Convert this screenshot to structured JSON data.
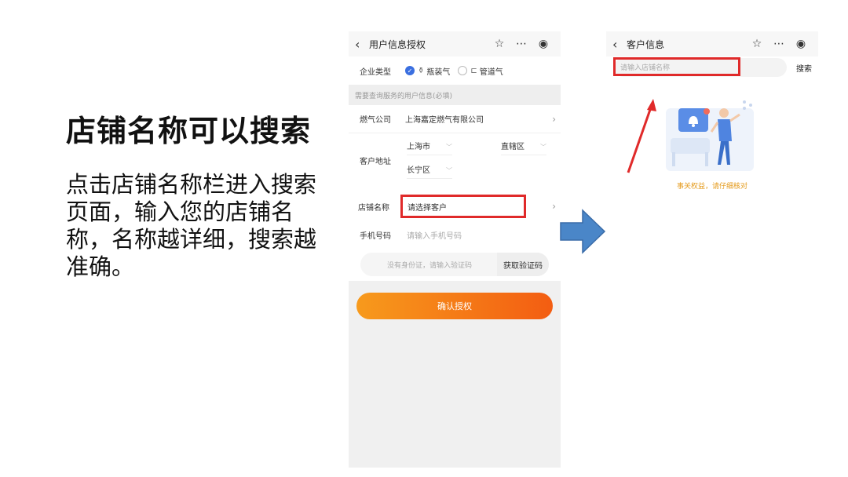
{
  "slide": {
    "title": "店铺名称可以搜索",
    "description": "点击店铺名称栏进入搜索页面，输入您的店铺名称，名称越详细，搜索越准确。"
  },
  "phone1": {
    "header": {
      "title": "用户信息授权"
    },
    "company_type": {
      "label": "企业类型",
      "option_bottled": "瓶装气",
      "option_pipe": "管道气",
      "selected": "瓶装气"
    },
    "section_hint": "需要查询服务的用户信息(必填)",
    "gas_company": {
      "label": "燃气公司",
      "value": "上海嘉定燃气有限公司"
    },
    "address": {
      "label": "客户地址",
      "city": "上海市",
      "area_type": "直辖区",
      "district": "长宁区"
    },
    "shop_name": {
      "label": "店铺名称",
      "placeholder": "请选择客户"
    },
    "phone": {
      "label": "手机号码",
      "placeholder": "请输入手机号码"
    },
    "verify": {
      "placeholder": "没有身份证，请输入验证码",
      "button": "获取验证码"
    },
    "confirm_button": "确认授权"
  },
  "phone2": {
    "header": {
      "title": "客户信息"
    },
    "search": {
      "placeholder": "请输入店铺名称",
      "button": "搜索"
    },
    "empty_tip": "事关权益，请仔细核对"
  },
  "colors": {
    "highlight_red": "#e02a2a",
    "accent_blue": "#3a6fe0",
    "arrow_blue": "#4a86c8",
    "button_orange": "#f47a16",
    "tip_orange": "#e49a1a"
  }
}
